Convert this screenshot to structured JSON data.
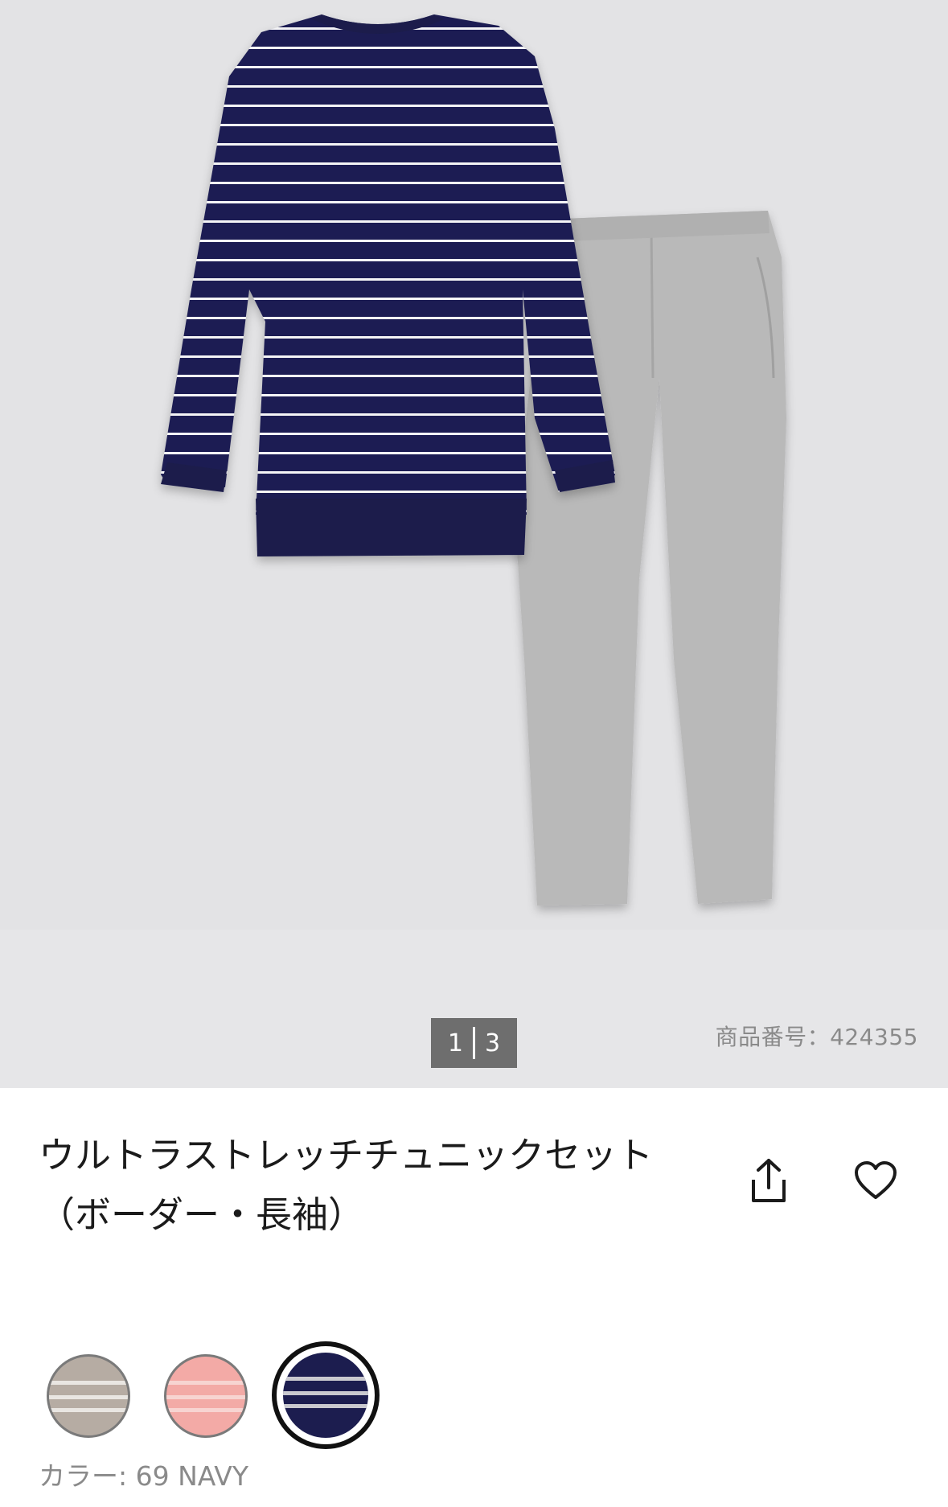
{
  "gallery": {
    "page_current": "1",
    "page_total": "3",
    "product_code": "商品番号：424355"
  },
  "product": {
    "title_line1": "ウルトラストレッチチュニックセット",
    "title_line2": "（ボーダー・長袖）",
    "share_icon": "share-icon",
    "favorite_icon": "heart-outline-icon"
  },
  "colors": {
    "swatches": [
      {
        "name": "beige-stripe",
        "base": "#b6aca3",
        "stripe": "#e9e6e2"
      },
      {
        "name": "pink-stripe",
        "base": "#f3aaa6",
        "stripe": "#f7d4d1"
      },
      {
        "name": "navy-stripe",
        "base": "#1c1d4f",
        "stripe": "#c9c9cf"
      }
    ],
    "selected_index": 2,
    "label": "カラー: 69 NAVY"
  },
  "palette": {
    "background": "#ffffff",
    "gallery_bg": "#e3e3e5",
    "navy": "#1c1d4f",
    "heather_gray": "#b9b9b9"
  }
}
